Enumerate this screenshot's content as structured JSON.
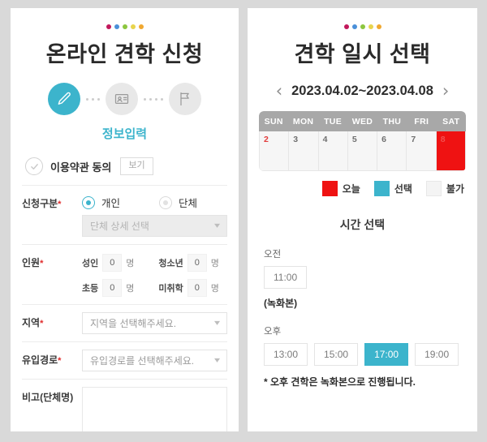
{
  "theme": {
    "accent": "#3cb4cc",
    "today_red": "#ef1212",
    "page_bg": "#d9d9d9",
    "panel_bg": "#ffffff",
    "calendar_header_gray": "#a8a8a8",
    "required_red": "#e02b2b"
  },
  "dots": [
    {
      "name": "dot-magenta",
      "color": "#c2185b"
    },
    {
      "name": "dot-blue",
      "color": "#4a90d9"
    },
    {
      "name": "dot-green",
      "color": "#8cc63f"
    },
    {
      "name": "dot-yellow",
      "color": "#e8d44d"
    },
    {
      "name": "dot-orange",
      "color": "#f0a830"
    }
  ],
  "left": {
    "title": "온라인 견학 신청",
    "steps": [
      {
        "icon": "pencil-icon",
        "state": "active"
      },
      {
        "icon": "id-card-icon",
        "state": "inactive"
      },
      {
        "icon": "flag-icon",
        "state": "inactive"
      }
    ],
    "step_label": "정보입력",
    "terms": {
      "check_icon": "check-icon",
      "label": "이용약관 동의",
      "view_button": "보기"
    },
    "fields": {
      "apply_type": {
        "label": "신청구분",
        "required": "*",
        "options": [
          {
            "label": "개인",
            "selected": true
          },
          {
            "label": "단체",
            "selected": false
          }
        ],
        "group_select": {
          "value": "단체 상세 선택",
          "disabled": true,
          "chevron": "chevron-down-icon"
        }
      },
      "headcount": {
        "label": "인원",
        "required": "*",
        "rows": [
          [
            {
              "name": "성인",
              "value": "0",
              "unit": "명"
            },
            {
              "name": "청소년",
              "value": "0",
              "unit": "명"
            }
          ],
          [
            {
              "name": "초등",
              "value": "0",
              "unit": "명"
            },
            {
              "name": "미취학",
              "value": "0",
              "unit": "명"
            }
          ]
        ]
      },
      "region": {
        "label": "지역",
        "required": "*",
        "placeholder": "지역을 선택해주세요.",
        "value": "지역을 선택해주세요.",
        "chevron": "chevron-down-icon"
      },
      "referral": {
        "label": "유입경로",
        "required": "*",
        "placeholder": "유입경로를 선택해주세요.",
        "value": "유입경로를 선택해주세요.",
        "chevron": "chevron-down-icon"
      },
      "note": {
        "label": "비고(단체명)",
        "required": "",
        "value": "",
        "placeholder": ""
      }
    }
  },
  "right": {
    "title": "견학 일시 선택",
    "date_nav": {
      "prev": "‹",
      "range": "2023.04.02~2023.04.08",
      "next": "›"
    },
    "calendar": {
      "weekdays": [
        "SUN",
        "MON",
        "TUE",
        "WED",
        "THU",
        "FRI",
        "SAT"
      ],
      "days": [
        {
          "num": "2",
          "state": "sunday"
        },
        {
          "num": "3",
          "state": "normal"
        },
        {
          "num": "4",
          "state": "normal"
        },
        {
          "num": "5",
          "state": "normal"
        },
        {
          "num": "6",
          "state": "normal"
        },
        {
          "num": "7",
          "state": "normal"
        },
        {
          "num": "8",
          "state": "today"
        }
      ]
    },
    "legend": [
      {
        "label": "오늘",
        "color": "#ef1212",
        "swatch": "today-swatch"
      },
      {
        "label": "선택",
        "color": "#3cb4cc",
        "swatch": "selected-swatch"
      },
      {
        "label": "불가",
        "color": "#f4f4f4",
        "swatch": "unavailable-swatch"
      }
    ],
    "time_title": "시간 선택",
    "morning": {
      "label": "오전",
      "slots": [
        {
          "time": "11:00",
          "selected": false
        }
      ],
      "note": "(녹화본)"
    },
    "afternoon": {
      "label": "오후",
      "slots": [
        {
          "time": "13:00",
          "selected": false
        },
        {
          "time": "15:00",
          "selected": false
        },
        {
          "time": "17:00",
          "selected": true
        },
        {
          "time": "19:00",
          "selected": false
        }
      ]
    },
    "footnote": "* 오후 견학은 녹화본으로 진행됩니다."
  }
}
